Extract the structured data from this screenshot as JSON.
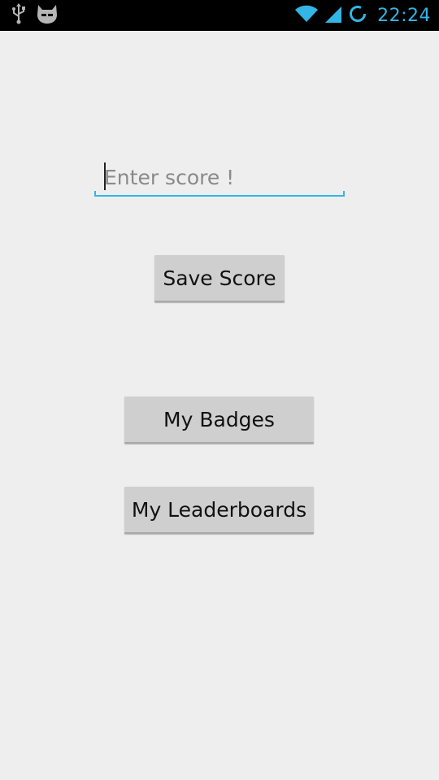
{
  "status_bar": {
    "time": "22:24",
    "icons": [
      "usb-icon",
      "cyanogenmod-icon",
      "wifi-icon",
      "signal-icon",
      "sync-icon"
    ],
    "accent_color": "#33b5e5"
  },
  "score_input": {
    "value": "",
    "placeholder": "Enter score !"
  },
  "buttons": {
    "save_score": "Save Score",
    "my_badges": "My Badges",
    "my_leaderboards": "My Leaderboards"
  }
}
